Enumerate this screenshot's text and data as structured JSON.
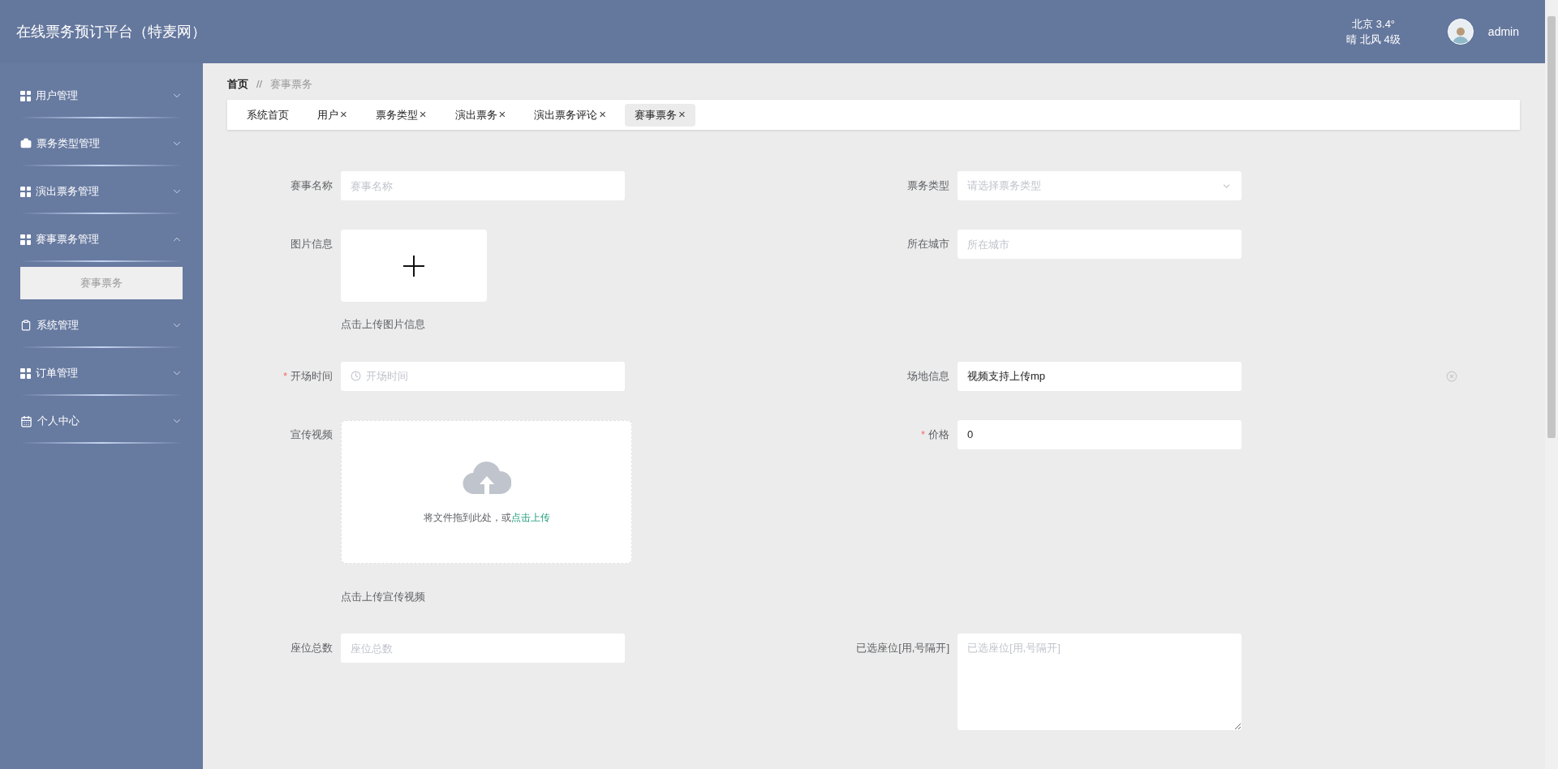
{
  "header": {
    "title": "在线票务预订平台（特麦网）",
    "weather": {
      "line1": "北京 3.4°",
      "line2": "晴 北风 4级"
    },
    "user": {
      "name": "admin"
    }
  },
  "sidebar": {
    "items": [
      {
        "label": "用户管理",
        "kind": "grid",
        "expanded": false
      },
      {
        "label": "票务类型管理",
        "kind": "briefcase",
        "expanded": false
      },
      {
        "label": "演出票务管理",
        "kind": "grid",
        "expanded": false
      },
      {
        "label": "赛事票务管理",
        "kind": "grid",
        "expanded": true,
        "children": [
          {
            "label": "赛事票务",
            "selected": true
          }
        ]
      },
      {
        "label": "系统管理",
        "kind": "clipboard",
        "expanded": false
      },
      {
        "label": "订单管理",
        "kind": "grid",
        "expanded": false
      },
      {
        "label": "个人中心",
        "kind": "calendar",
        "expanded": false
      }
    ]
  },
  "breadcrumb": {
    "items": [
      "首页",
      "赛事票务"
    ],
    "separator": "//"
  },
  "tabs": [
    {
      "label": "系统首页",
      "selected": false
    },
    {
      "label": "用户",
      "close": "×",
      "selected": false
    },
    {
      "label": "票务类型",
      "close": "×",
      "selected": false
    },
    {
      "label": "演出票务",
      "close": "×",
      "selected": false
    },
    {
      "label": "演出票务评论",
      "close": "×",
      "selected": false
    },
    {
      "label": "赛事票务",
      "close": "×",
      "selected": true
    }
  ],
  "form": {
    "rows": [
      [
        {
          "kind": "text",
          "label": "赛事名称",
          "placeholder": "赛事名称"
        },
        {
          "kind": "select",
          "label": "票务类型",
          "placeholder": "请选择票务类型"
        }
      ],
      [
        {
          "kind": "image_upload",
          "label": "图片信息",
          "hint": "点击上传图片信息"
        },
        {
          "kind": "text",
          "label": "所在城市",
          "placeholder": "所在城市"
        }
      ],
      [
        {
          "kind": "datetime",
          "label": "开场时间",
          "required_mark": "*",
          "placeholder": "开场时间"
        },
        {
          "kind": "text",
          "label": "场地信息",
          "value": "视频支持上传mp",
          "clearable": true
        }
      ],
      [
        {
          "kind": "video_upload",
          "label": "宣传视频",
          "drop_text": "将文件拖到此处，或",
          "link": "点击上传",
          "hint": "点击上传宣传视频"
        },
        {
          "kind": "text",
          "label": "价格",
          "required_mark": "*",
          "value": "0"
        }
      ],
      [
        {
          "kind": "text",
          "label": "座位总数",
          "placeholder": "座位总数"
        },
        {
          "kind": "textarea",
          "label": "已选座位[用,号隔开]",
          "placeholder": "已选座位[用,号隔开]"
        }
      ]
    ]
  }
}
